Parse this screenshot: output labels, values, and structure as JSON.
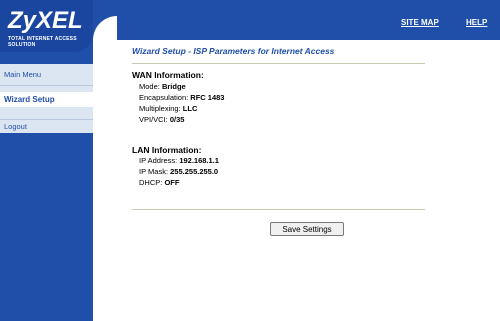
{
  "brand": {
    "name": "ZyXEL",
    "tagline": "TOTAL INTERNET ACCESS SOLUTION"
  },
  "topnav": {
    "site_map": "SITE MAP",
    "help": "HELP"
  },
  "sidebar": {
    "items": [
      {
        "label": "Main Menu"
      },
      {
        "label": "Wizard Setup",
        "active": true
      },
      {
        "label": "Logout"
      }
    ]
  },
  "page": {
    "title": "Wizard Setup - ISP Parameters for Internet Access"
  },
  "wan": {
    "heading": "WAN Information:",
    "rows": [
      {
        "label": "Mode:",
        "value": "Bridge"
      },
      {
        "label": "Encapsulation:",
        "value": "RFC 1483"
      },
      {
        "label": "Multiplexing:",
        "value": "LLC"
      },
      {
        "label": "VPI/VCI:",
        "value": "0/35"
      }
    ]
  },
  "lan": {
    "heading": "LAN Information:",
    "rows": [
      {
        "label": "IP Address:",
        "value": "192.168.1.1"
      },
      {
        "label": "IP Mask:",
        "value": "255.255.255.0"
      },
      {
        "label": "DHCP:",
        "value": "OFF"
      }
    ]
  },
  "actions": {
    "save_label": "Save Settings"
  },
  "colors": {
    "brand_blue": "#1f4fa8",
    "sidebar_bg": "#dce6f2"
  }
}
